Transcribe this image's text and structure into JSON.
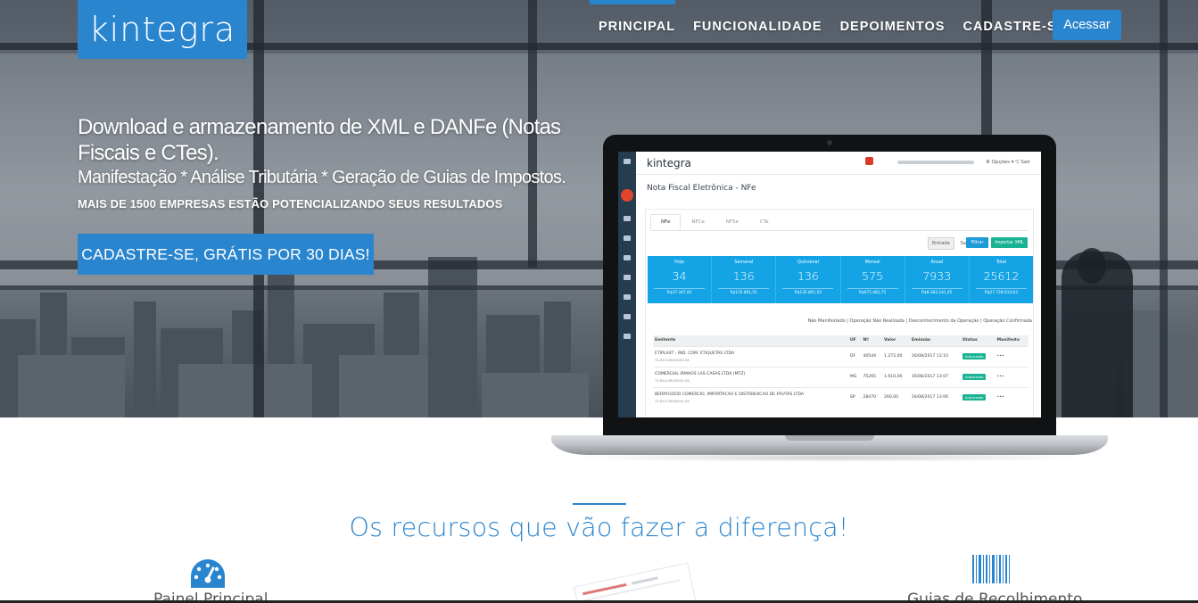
{
  "brand": {
    "logo_text": "kintegra",
    "accent_color": "#2a85cf"
  },
  "nav": {
    "items": [
      "PRINCIPAL",
      "FUNCIONALIDADE",
      "DEPOIMENTOS",
      "CADASTRE-SE"
    ],
    "active": "PRINCIPAL",
    "login_label": "Acessar"
  },
  "hero": {
    "title": "Download e armazenamento de XML e DANFe (Notas Fiscais e CTes).",
    "subtitle": "Manifestação * Análise Tributária * Geração de Guias de Impostos.",
    "tagline": "MAIS DE 1500 EMPRESAS ESTÃO POTENCIALIZANDO SEUS RESULTADOS",
    "cta_label": "CADASTRE-SE, GRÁTIS POR 30 DIAS!"
  },
  "app_preview": {
    "logo_text": "kintegra",
    "options_label": "⚙ Opções ▾   ⎋ Sair",
    "page_heading": "Nota Fiscal Eletrônica - NFe",
    "tabs": [
      "NFe",
      "NFCe",
      "NFSe",
      "CTe"
    ],
    "active_tab": "NFe",
    "toggle": {
      "entrada": "Entrada",
      "saida": "Saída"
    },
    "buttons": {
      "filter": "Filtrar",
      "import": "Importar XML"
    },
    "stats": [
      {
        "label": "Hoje",
        "value": "34",
        "money": "R$37.447,92"
      },
      {
        "label": "Semanal",
        "value": "136",
        "money": "R$135.801,55"
      },
      {
        "label": "Quinzenal",
        "value": "136",
        "money": "R$135.801,55"
      },
      {
        "label": "Mensal",
        "value": "575",
        "money": "R$675.481,75"
      },
      {
        "label": "Anual",
        "value": "7933",
        "money": "R$8.362.241,45"
      },
      {
        "label": "Total",
        "value": "25612",
        "money": "R$27.728.614,63"
      }
    ],
    "legend": "Não Manifestado | Operação Não Realizada | Desconhecimento da Operação | Operação Confirmada",
    "table": {
      "headers": [
        "Emitente",
        "UF",
        "Nº",
        "Valor",
        "Emissão",
        "Status",
        "Manifesto"
      ],
      "rows": [
        {
          "emitente": "ETIPLAST - IND. COM. ETIQUETAS LTDA",
          "cnpj": "72.614.092/0001-00",
          "uf": "DF",
          "numero": "40544",
          "valor": "1.272,00",
          "emissao": "16/08/2017 13:10",
          "status": "Autorizada",
          "manifesto": "•••"
        },
        {
          "emitente": "COMERCIAL IRMAOS LAS CASAS LTDA (MTZ)",
          "cnpj": "72.614.092/0001-00",
          "uf": "MG",
          "numero": "75265",
          "valor": "1.610,00",
          "emissao": "16/08/2017 13:07",
          "status": "Autorizada",
          "manifesto": "•••"
        },
        {
          "emitente": "BERRYGOOD COMERCIO, IMPORTACAO E DISTRIBUICAO DE FRUTAS LTDA",
          "cnpj": "72.614.092/0001-00",
          "uf": "SP",
          "numero": "28470",
          "valor": "260,00",
          "emissao": "16/08/2017 13:06",
          "status": "Autorizada",
          "manifesto": "•••"
        }
      ]
    }
  },
  "features": {
    "title": "Os recursos que vão fazer a diferença!",
    "items": [
      {
        "label": "Painel Principal",
        "icon": "dashboard-gauge-icon"
      },
      {
        "label": "",
        "icon": "screenshot-preview"
      },
      {
        "label": "Guias de Recolhimento",
        "icon": "barcode-icon"
      }
    ]
  }
}
